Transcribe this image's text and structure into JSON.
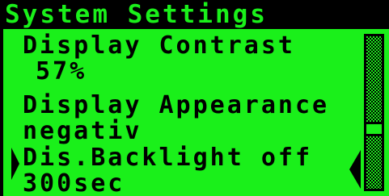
{
  "title": "System Settings",
  "menu": {
    "items": [
      {
        "label": "Display Contrast",
        "value": "57%"
      },
      {
        "label": "Display Appearance",
        "value": "negativ"
      },
      {
        "label": "Dis.Backlight off",
        "value": "300sec",
        "selected": true
      }
    ]
  },
  "scrollbar": {
    "position": 0.64
  },
  "colors": {
    "background": "#1af01a",
    "foreground": "#000000"
  },
  "icons": {
    "selection_left": "triangle-right-icon",
    "selection_right": "triangle-left-icon"
  }
}
